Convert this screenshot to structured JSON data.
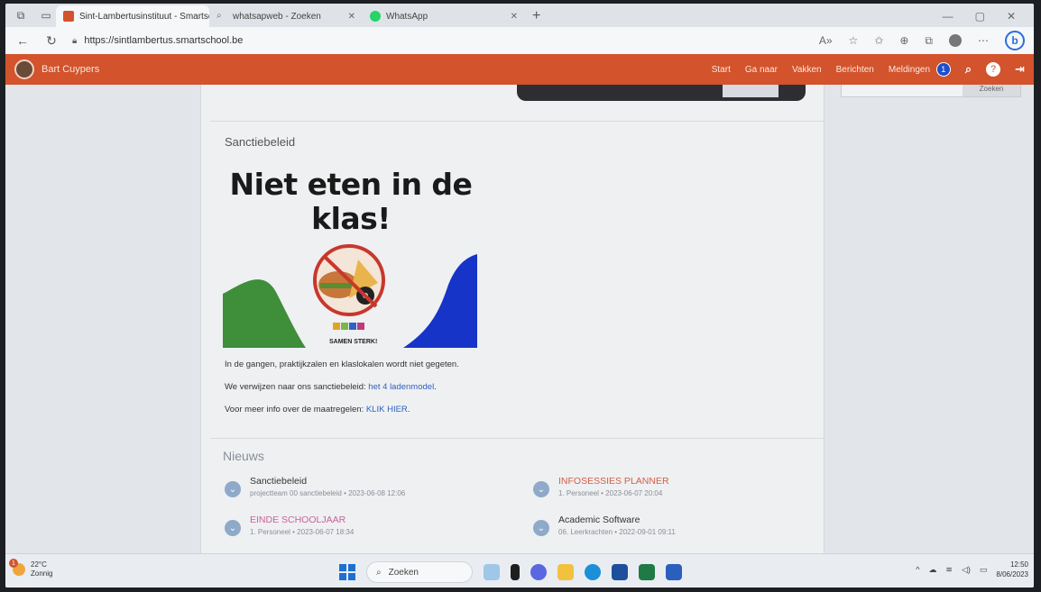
{
  "browser": {
    "tabs": [
      {
        "label": "Sint-Lambertusinstituut - Smartsc",
        "favicon_color": "#d2532c",
        "active": true
      },
      {
        "label": "whatsapweb - Zoeken",
        "favicon_color": "#888888",
        "active": false
      },
      {
        "label": "WhatsApp",
        "favicon_color": "#25d366",
        "active": false
      }
    ],
    "url": "https://sintlambertus.smartschool.be"
  },
  "smartschool": {
    "user_name": "Bart Cuypers",
    "nav": {
      "start": "Start",
      "ga_naar": "Ga naar",
      "vakken": "Vakken",
      "berichten": "Berichten",
      "meldingen": "Meldingen",
      "meldingen_count": "1"
    },
    "search_button": "Zoeken"
  },
  "main": {
    "section_title": "Sanctiebeleid",
    "poster_headline": "Niet eten in de klas!",
    "poster_tagline": "SAMEN STERK!",
    "para1": "In de gangen, praktijkzalen en klaslokalen wordt niet gegeten.",
    "para2_prefix": "We verwijzen naar ons sanctiebeleid: ",
    "para2_link": "het 4 ladenmodel",
    "para3_prefix": "Voor meer info over  de maatregelen: ",
    "para3_link": "KLIK HIER",
    "news_title": "Nieuws",
    "news": [
      {
        "title": "Sanctiebeleid",
        "meta": "projectteam 00 sanctiebeleid • 2023-06-08 12:06"
      },
      {
        "title": "INFOSESSIES PLANNER",
        "meta": "1. Personeel • 2023-06-07 20:04"
      },
      {
        "title": "EINDE SCHOOLJAAR",
        "meta": "1. Personeel • 2023-06-07 18:34"
      },
      {
        "title": "Academic Software",
        "meta": "06. Leerkrachten • 2022-09-01 09:11"
      }
    ]
  },
  "taskbar": {
    "temperature": "22°C",
    "weather": "Zonnig",
    "weather_badge": "1",
    "search_label": "Zoeken",
    "time": "12:50",
    "date": "8/06/2023"
  },
  "colors": {
    "smartschool_orange": "#d2532c",
    "link_blue": "#2f5fc0",
    "notification_blue": "#1f4fc9"
  }
}
